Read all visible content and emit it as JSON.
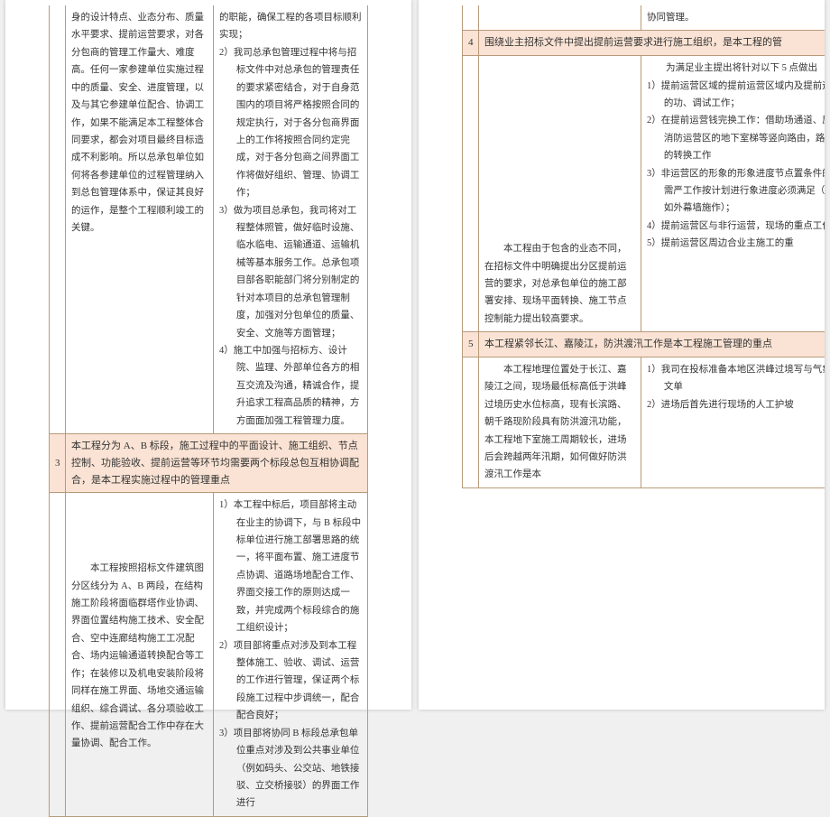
{
  "leftPage": {
    "row2": {
      "col2": "身的设计特点、业态分布、质量水平要求、提前运营要求，对各分包商的管理工作量大、难度高。任何一家参建单位实施过程中的质量、安全、进度管理，以及与其它参建单位配合、协调工作，如果不能满足本工程整体合同要求，都会对项目最终目标造成不利影响。所以总承包单位如何将各参建单位的过程管理纳入到总包管理体系中，保证其良好的运作，是整个工程顺利竣工的关键。",
      "col3_p1": "的职能，确保工程的各项目标顺利实现；",
      "col3_li2": "2）我司总承包管理过程中将与招标文件中对总承包的管理责任的要求紧密结合，对于自身范围内的项目将严格按照合同的规定执行，对于各分包商界面上的工作将按照合同约定完成，对于各分包商之间界面工作将做好组织、管理、协调工作；",
      "col3_li3": "3）做为项目总承包，我司将对工程整体照管，做好临时设施、临水临电、运输通道、运输机械等基本服务工作。总承包项目部各职能部门将分别制定的针对本项目的总承包管理制度，加强对分包单位的质量、安全、文施等方面管理；",
      "col3_li4": "4）施工中加强与招标方、设计院、监理、外部单位各方的相互交流及沟通，精诚合作，提升追求工程高品质的精神，方方面面加强工程管理力度。"
    },
    "section3": {
      "num": "3",
      "title": "本工程分为 A、B 标段，施工过程中的平面设计、施工组织、节点控制、功能验收、提前运营等环节均需要两个标段总包互相协调配合，是本工程实施过程中的管理重点"
    },
    "row3": {
      "col2": "　　本工程按照招标文件建筑图分区线分为 A、B 两段，在结构施工阶段将面临群塔作业协调、界面位置结构施工技术、安全配合、空中连廊结构施工工况配合、场内运输通道转换配合等工作；在装修以及机电安装阶段将同样在施工界面、场地交通运输组织、综合调试、各分项验收工作、提前运营配合工作中存在大量协调、配合工作。",
      "col3_li1": "1）本工程中标后，项目部将主动在业主的协调下，与 B 标段中标单位进行施工部署思路的统一，将平面布置、施工进度节点协调、道路场地配合工作、界面交接工作的原则达成一致，并完成两个标段综合的施工组织设计；",
      "col3_li2": "2）项目部将重点对涉及到本工程整体施工、验收、调试、运营的工作进行管理，保证两个标段施工过程中步调统一，配合配合良好；",
      "col3_li3": "3）项目部将协同 B 标段总承包单位重点对涉及到公共事业单位（例如码头、公交站、地铁接驳、立交桥接驳）的界面工作进行"
    }
  },
  "rightPage": {
    "row_cont": {
      "col3": "协同管理。"
    },
    "section4": {
      "num": "4",
      "title": "围绕业主招标文件中提出提前运营要求进行施工组织，是本工程的管"
    },
    "row4": {
      "col2": "　　本工程由于包含的业态不同，在招标文件中明确提出分区提前运营的要求，对总承包单位的施工部署安排、现场平面转换、施工节点控制能力提出较高要求。",
      "col3_p1": "　　为满足业主提出将针对以下 5 点做出",
      "col3_li1": "1）提前运营区域的提前运营区域内及提前运营的功、调试工作；",
      "col3_li2": "2）在提前运营钱完换工作：借助场通道、屋面消防运营区的地下室梯等竖向路由，路由的转换工作",
      "col3_li3": "3）非运营区的形象的形象进度节点置条件的，需严工作按计划进行象进度必须满足（例如外幕墙施作）；",
      "col3_li4": "4）提前运营区与非行运营，现场的重点工作；",
      "col3_li5": "5）提前运营区周边合业主施工的重"
    },
    "section5": {
      "num": "5",
      "title": "本工程紧邻长江、嘉陵江，防洪渡汛工作是本工程施工管理的重点"
    },
    "row5": {
      "col2": "　　本工程地理位置处于长江、嘉陵江之间，现场最低标高低于洪峰过境历史水位标高，现有长滨路、朝千路现阶段具有防洪渡汛功能，本工程地下室施工周期较长，进场后会跨越两年汛期，如何做好防洪渡汛工作是本",
      "col3_li1": "1）我司在投标准备本地区洪峰过境写与气象水文单",
      "col3_li2": "2）进场后首先进行现场的人工护坡"
    }
  }
}
